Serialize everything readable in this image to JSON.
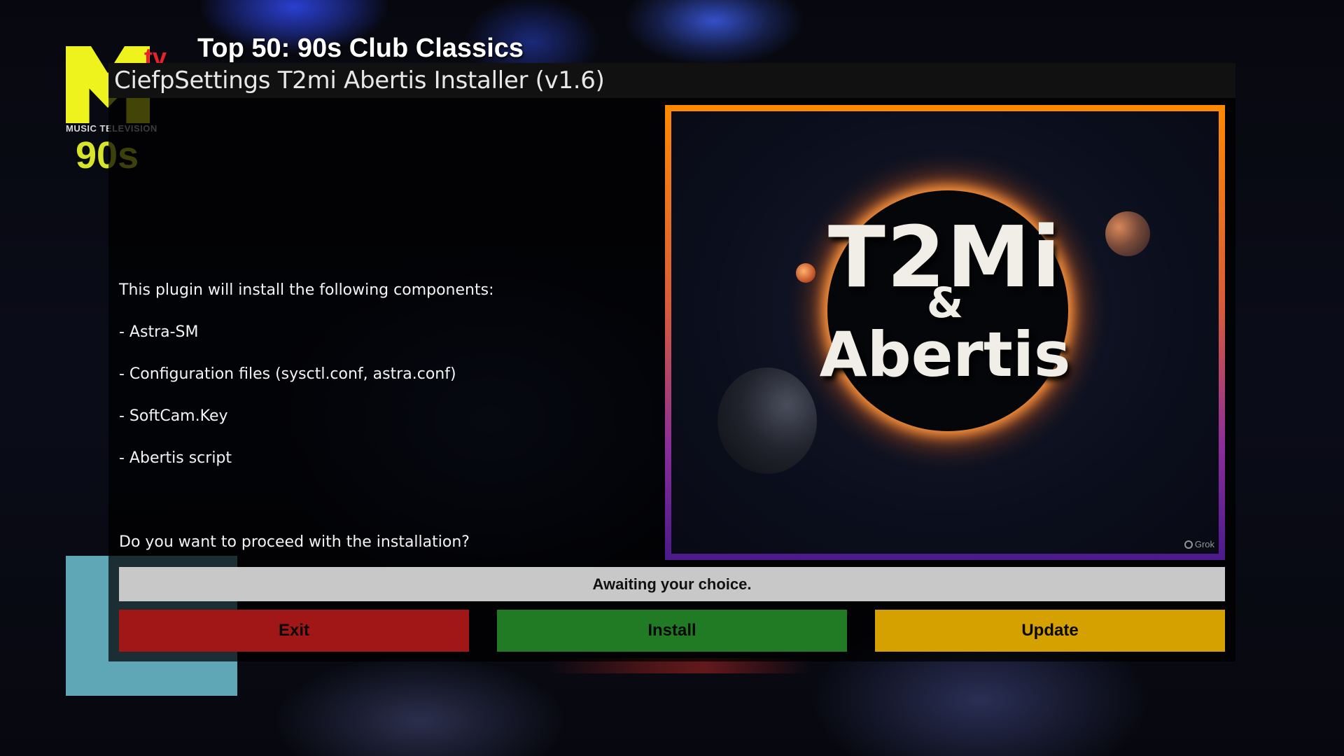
{
  "channel": {
    "logo_text": "MTV",
    "logo_subtitle": "MUSIC TELEVISION",
    "logo_90s": "90s",
    "program_title": "Top 50: 90s Club Classics"
  },
  "window": {
    "title": "CiefpSettings T2mi Abertis Installer (v1.6)"
  },
  "info": {
    "lines": [
      "This plugin will install the following components:",
      "- Astra-SM",
      "- Configuration files (sysctl.conf, astra.conf)",
      "- SoftCam.Key",
      "- Abertis script",
      "",
      "Do you want to proceed with the installation?"
    ]
  },
  "preview": {
    "logo_line1": "T2Mi",
    "logo_amp": "&",
    "logo_line2": "Abertis",
    "watermark": "Grok",
    "frame_colors": [
      "#ff8a00",
      "#4a1a8c"
    ]
  },
  "status": {
    "text": "Awaiting your choice."
  },
  "buttons": {
    "exit": {
      "label": "Exit",
      "color": "#a11616"
    },
    "install": {
      "label": "Install",
      "color": "#217a24"
    },
    "update": {
      "label": "Update",
      "color": "#d4a100"
    }
  }
}
